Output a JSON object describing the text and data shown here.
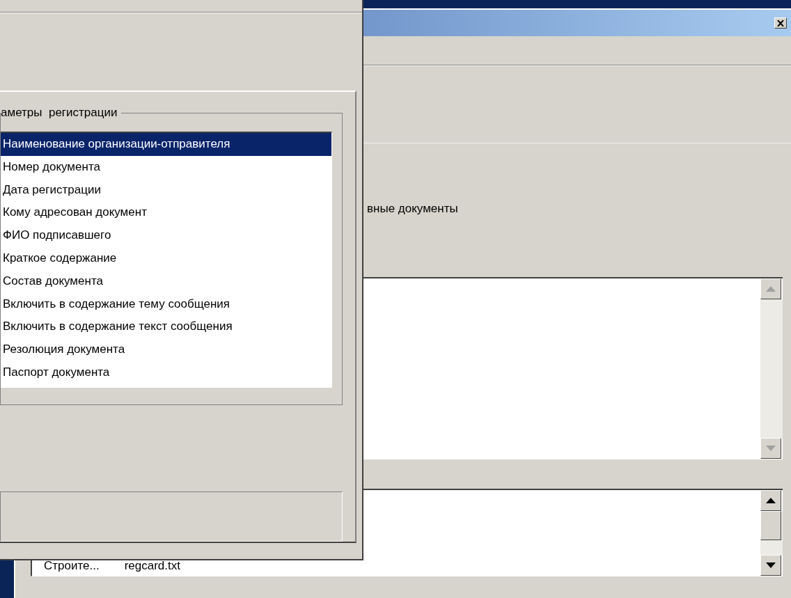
{
  "back_window": {
    "group_label": "вные документы",
    "documents_list": {
      "scrollbar_disabled": true
    },
    "files_list": {
      "scrollbar_disabled": false,
      "rows": [
        {
          "name": "Строите...",
          "file": "regcard.txt"
        }
      ]
    }
  },
  "dialog": {
    "group_label": "аметры  регистрации",
    "fields": [
      {
        "label": "Наименование организации-отправителя",
        "selected": true
      },
      {
        "label": "Номер документа",
        "selected": false
      },
      {
        "label": "Дата регистрации",
        "selected": false
      },
      {
        "label": "Кому адресован документ",
        "selected": false
      },
      {
        "label": "ФИО подписавшего",
        "selected": false
      },
      {
        "label": "Краткое содержание",
        "selected": false
      },
      {
        "label": "Состав документа",
        "selected": false
      },
      {
        "label": "Включить в содержание тему сообщения",
        "selected": false
      },
      {
        "label": "Включить в содержание текст сообщения",
        "selected": false
      },
      {
        "label": "Резолюция документа",
        "selected": false
      },
      {
        "label": "Паспорт документа",
        "selected": false
      }
    ]
  }
}
